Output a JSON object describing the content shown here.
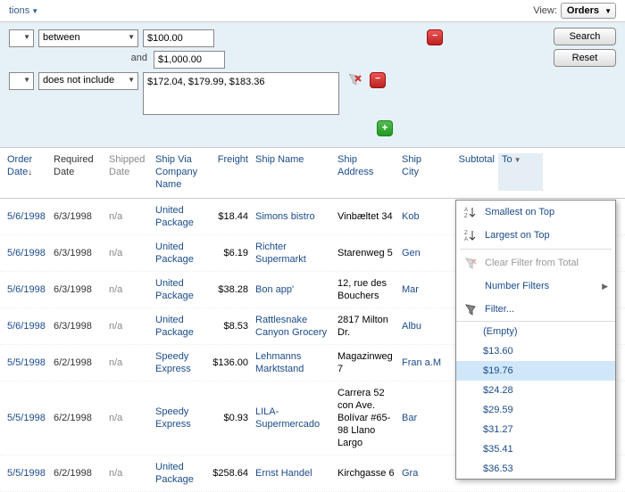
{
  "header": {
    "left_text_fragment": "tions",
    "view_label": "View:",
    "view_value": "Orders"
  },
  "filters": {
    "row1": {
      "operator": "between",
      "value1": "$100.00",
      "and_label": "and",
      "value2": "$1,000.00"
    },
    "row2": {
      "operator": "does not include",
      "value": "$172.04, $179.99, $183.36"
    },
    "buttons": {
      "search": "Search",
      "reset": "Reset"
    }
  },
  "columns": {
    "order_date": "Order Date",
    "required_date": "Required Date",
    "shipped_date": "Shipped Date",
    "ship_via": "Ship Via Company Name",
    "freight": "Freight",
    "ship_name": "Ship Name",
    "ship_address": "Ship Address",
    "ship_city": "Ship City",
    "subtotal": "Subtotal",
    "total_fragment": "To"
  },
  "rows": [
    {
      "order_date": "5/6/1998",
      "required_date": "6/3/1998",
      "shipped_date": "n/a",
      "ship_via": "United Package",
      "freight": "$18.44",
      "ship_name": "Simons bistro",
      "ship_address": "Vinbæltet 34",
      "ship_city": "Kob"
    },
    {
      "order_date": "5/6/1998",
      "required_date": "6/3/1998",
      "shipped_date": "n/a",
      "ship_via": "United Package",
      "freight": "$6.19",
      "ship_name": "Richter Supermarkt",
      "ship_address": "Starenweg 5",
      "ship_city": "Gen"
    },
    {
      "order_date": "5/6/1998",
      "required_date": "6/3/1998",
      "shipped_date": "n/a",
      "ship_via": "United Package",
      "freight": "$38.28",
      "ship_name": "Bon app'",
      "ship_address": "12, rue des Bouchers",
      "ship_city": "Mar"
    },
    {
      "order_date": "5/6/1998",
      "required_date": "6/3/1998",
      "shipped_date": "n/a",
      "ship_via": "United Package",
      "freight": "$8.53",
      "ship_name": "Rattlesnake Canyon Grocery",
      "ship_address": "2817 Milton Dr.",
      "ship_city": "Albu"
    },
    {
      "order_date": "5/5/1998",
      "required_date": "6/2/1998",
      "shipped_date": "n/a",
      "ship_via": "Speedy Express",
      "freight": "$136.00",
      "ship_name": "Lehmanns Marktstand",
      "ship_address": "Magazinweg 7",
      "ship_city": "Fran a.M"
    },
    {
      "order_date": "5/5/1998",
      "required_date": "6/2/1998",
      "shipped_date": "n/a",
      "ship_via": "Speedy Express",
      "freight": "$0.93",
      "ship_name": "LILA-Supermercado",
      "ship_address": "Carrera 52 con Ave. Bolívar #65-98 Llano Largo",
      "ship_city": "Bar"
    },
    {
      "order_date": "5/5/1998",
      "required_date": "6/2/1998",
      "shipped_date": "n/a",
      "ship_via": "United Package",
      "freight": "$258.64",
      "ship_name": "Ernst Handel",
      "ship_address": "Kirchgasse 6",
      "ship_city": "Gra"
    }
  ],
  "context_menu": {
    "smallest": "Smallest on Top",
    "largest": "Largest on Top",
    "clear": "Clear Filter from Total",
    "number_filters": "Number Filters",
    "filter": "Filter...",
    "empty": "(Empty)",
    "values": [
      "$13.60",
      "$19.76",
      "$24.28",
      "$29.59",
      "$31.27",
      "$35.41",
      "$36.53"
    ],
    "selected_value": "$19.76"
  }
}
